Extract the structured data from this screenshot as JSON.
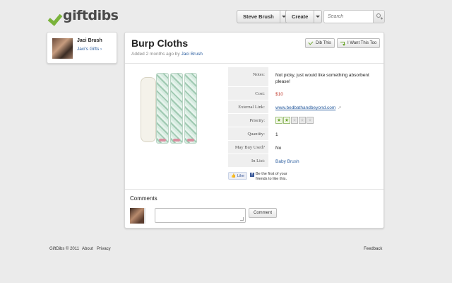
{
  "brand": {
    "name": "giftdibs",
    "check_color": "#7ab33b"
  },
  "header": {
    "user_button": "Steve Brush",
    "create_button": "Create",
    "search_placeholder": "Search"
  },
  "profile": {
    "name": "Jaci Brush",
    "gifts_link": "Jaci's Gifts ›"
  },
  "item": {
    "title": "Burp Cloths",
    "added_prefix": "Added 2 months ago by",
    "added_by": "Jaci Brush",
    "dib_button": "Dib This",
    "want_button": "I Want This Too",
    "details": {
      "notes_label": "Notes:",
      "notes": "Not picky, just would like something absorbent please!",
      "cost_label": "Cost:",
      "cost": "$10",
      "link_label": "External Link:",
      "link": "www.bedbathandbeyond.com",
      "priority_label": "Priority:",
      "priority": 2,
      "priority_max": 5,
      "quantity_label": "Quantity:",
      "quantity": "1",
      "maybuy_label": "May Buy Used?",
      "maybuy": "No",
      "list_label": "In List:",
      "list": "Baby Brush"
    },
    "facebook": {
      "like_label": "Like",
      "text": "Be the first of your friends to like this."
    }
  },
  "comments": {
    "heading": "Comments",
    "button": "Comment"
  },
  "footer": {
    "copyright": "GiftDibs © 2011",
    "about": "About",
    "privacy": "Privacy",
    "feedback": "Feedback"
  }
}
